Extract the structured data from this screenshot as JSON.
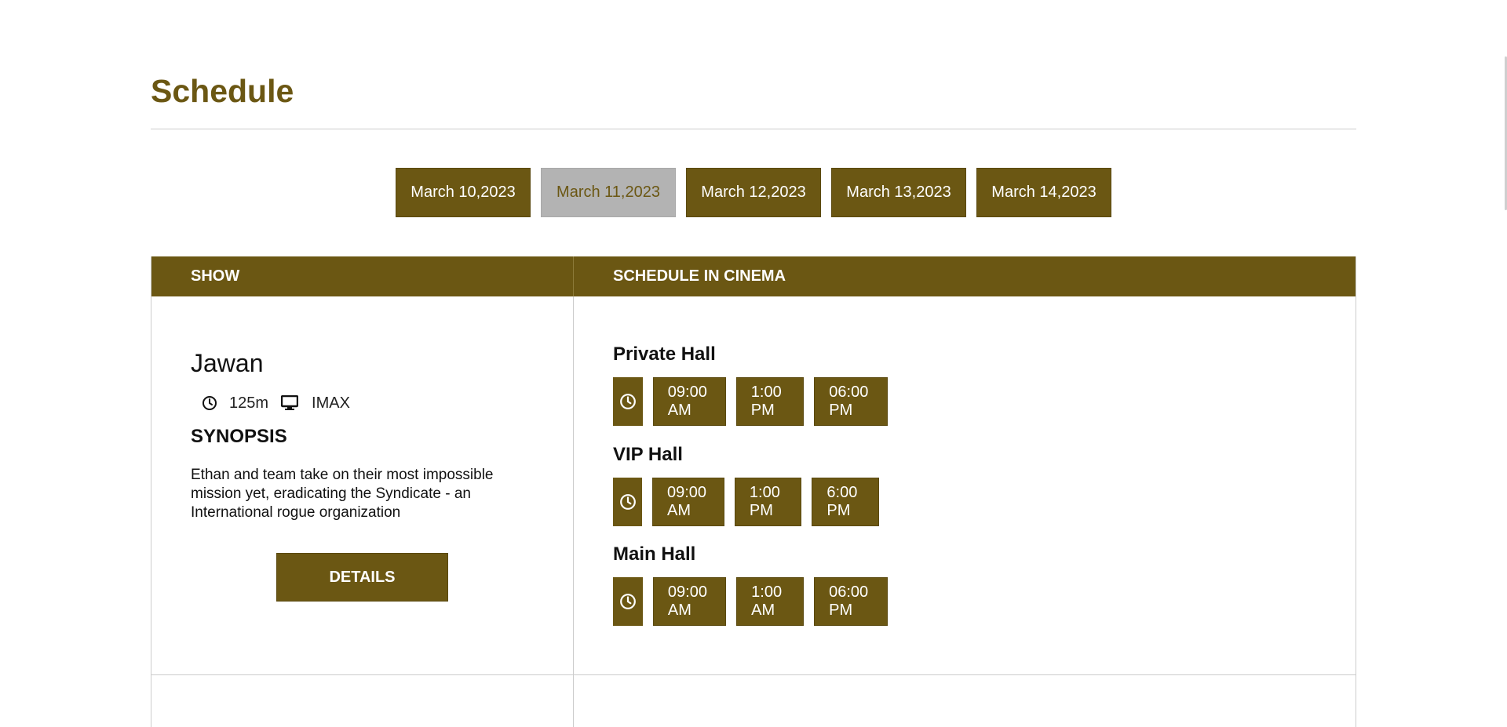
{
  "page": {
    "title": "Schedule"
  },
  "dates": [
    {
      "label": "March 10,2023",
      "active": false
    },
    {
      "label": "March 11,2023",
      "active": true
    },
    {
      "label": "March 12,2023",
      "active": false
    },
    {
      "label": "March 13,2023",
      "active": false
    },
    {
      "label": "March 14,2023",
      "active": false
    }
  ],
  "table": {
    "headers": {
      "show": "SHOW",
      "schedule": "SCHEDULE IN CINEMA"
    }
  },
  "movie": {
    "title": "Jawan",
    "duration": "125m",
    "format": "IMAX",
    "duration_icon": "clock-icon",
    "format_icon": "monitor-icon",
    "synopsis_heading": "SYNOPSIS",
    "synopsis": "Ethan and team take on their most impossible mission yet, eradicating the Syndicate - an International rogue organization",
    "details_label": "DETAILS"
  },
  "halls": [
    {
      "name": "Private Hall",
      "times": [
        "09:00 AM",
        "1:00 PM",
        "06:00 PM"
      ]
    },
    {
      "name": "VIP Hall",
      "times": [
        "09:00 AM",
        "1:00 PM",
        "6:00 PM"
      ]
    },
    {
      "name": "Main Hall",
      "times": [
        "09:00 AM",
        "1:00 AM",
        "06:00 PM"
      ]
    }
  ],
  "colors": {
    "accent": "#6b5713",
    "inactive_tab": "#b3b3b3",
    "rule": "#cccccc"
  }
}
